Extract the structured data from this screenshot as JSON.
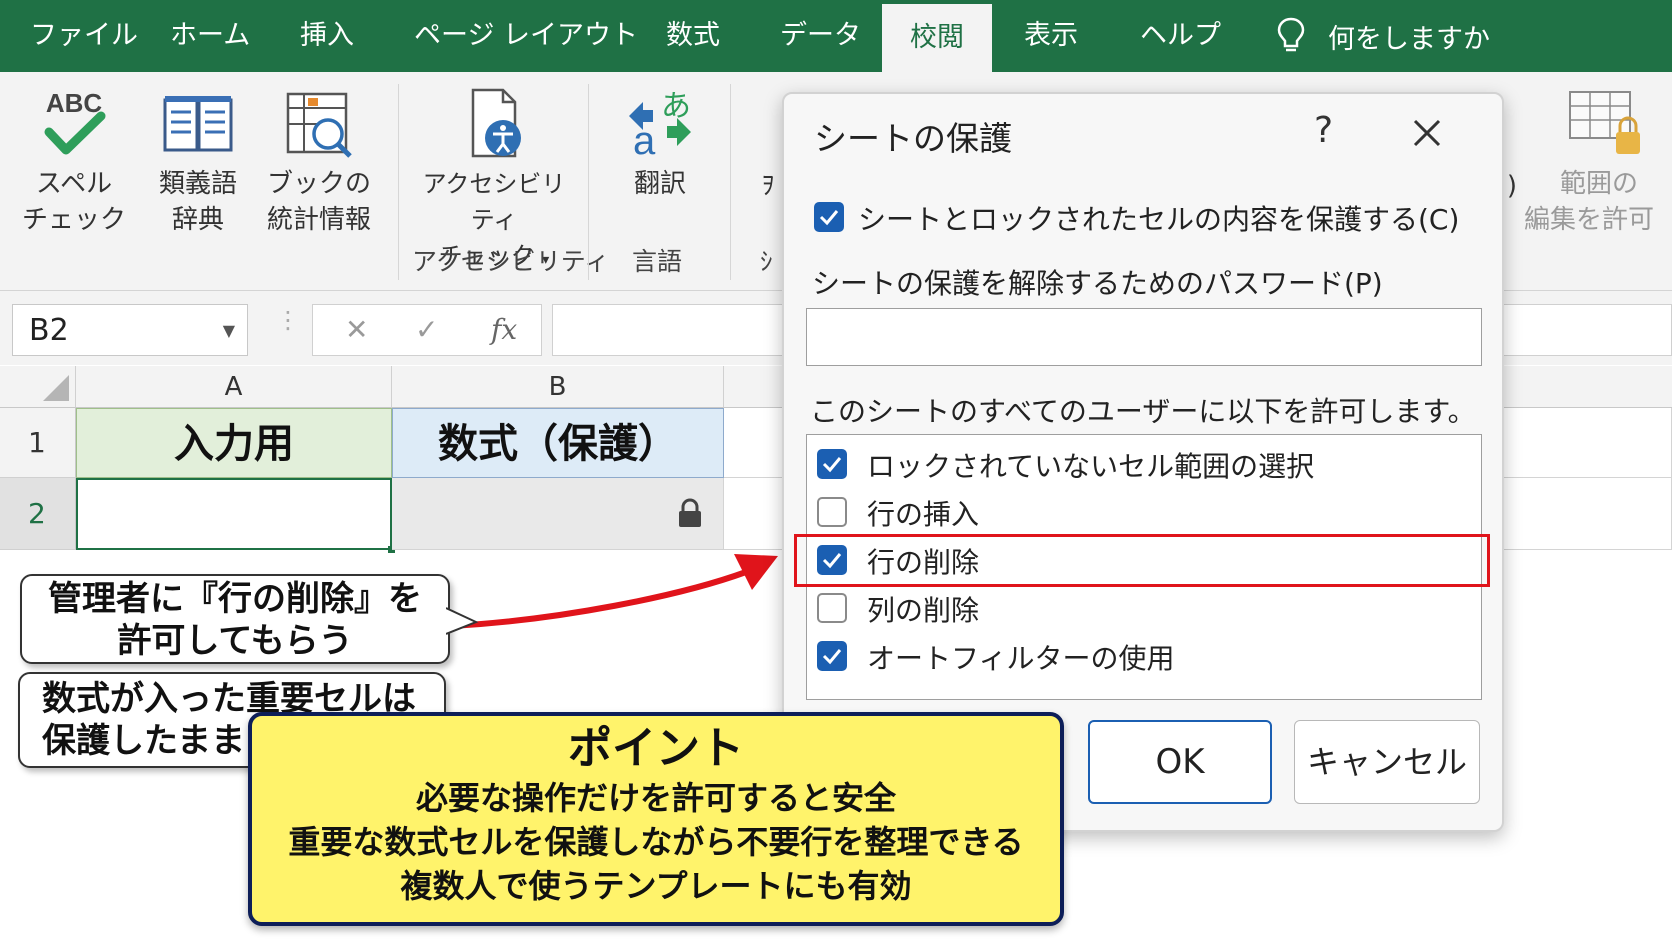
{
  "tabs": [
    {
      "label": "ファイル"
    },
    {
      "label": "ホーム"
    },
    {
      "label": "挿入"
    },
    {
      "label": "ページ レイアウト"
    },
    {
      "label": "数式"
    },
    {
      "label": "データ"
    },
    {
      "label": "校閲",
      "active": true
    },
    {
      "label": "表示"
    },
    {
      "label": "ヘルプ"
    }
  ],
  "tell_me": "何をしますか",
  "ribbon": {
    "spell_line1": "スペル",
    "spell_line2": "チェック",
    "spell_icon_text": "ABC",
    "thesaurus_line1": "類義語",
    "thesaurus_line2": "辞典",
    "stats_line1": "ブックの",
    "stats_line2": "統計情報",
    "access_line1": "アクセシビリティ",
    "access_line2": "チェック",
    "access_group": "アクセシビリティ",
    "translate_label": "翻訳",
    "translate_icon_text": "あ",
    "lang_group": "言語",
    "cut_off_1": "ｦ",
    "cut_off_2": "ｼ",
    "cut_off_3": ")",
    "allow_range_line1": "範囲の",
    "allow_range_line2": "編集を許可"
  },
  "formula_bar": {
    "name_box": "B2",
    "cancel_glyph": "✕",
    "enter_glyph": "✓",
    "fx_glyph": "fx"
  },
  "grid": {
    "col_a": "A",
    "col_b": "B",
    "row_1": "1",
    "row_2": "2",
    "a1": "入力用",
    "b1": "数式（保護）"
  },
  "dialog": {
    "title": "シートの保護",
    "help": "?",
    "protect_label": "シートとロックされたセルの内容を保護する(C)",
    "password_label": "シートの保護を解除するためのパスワード(P)",
    "allow_label": "このシートのすべてのユーザーに以下を許可します。",
    "options": [
      {
        "label": "ロックされていないセル範囲の選択",
        "checked": true
      },
      {
        "label": "行の挿入",
        "checked": false
      },
      {
        "label": "行の削除",
        "checked": true
      },
      {
        "label": "列の削除",
        "checked": false
      },
      {
        "label": "オートフィルターの使用",
        "checked": true
      }
    ],
    "ok": "OK",
    "cancel": "キャンセル"
  },
  "callouts": {
    "c1_line1": "管理者に『行の削除』を",
    "c1_line2": "許可してもらう",
    "c2_line1": "数式が入った重要セルは",
    "c2_line2": "保護したまま"
  },
  "point": {
    "title": "ポイント",
    "lines": [
      "必要な操作だけを許可すると安全",
      "重要な数式セルを保護しながら不要行を整理できる",
      "複数人で使うテンプレートにも有効"
    ]
  },
  "colors": {
    "excel_green": "#1f7145",
    "check_blue": "#1b5fb2",
    "highlight_red": "#e0141b",
    "input_cell_fill": "#e2efda",
    "formula_cell_fill": "#ddebf7",
    "point_fill": "#fff36b",
    "point_border": "#0d1e58"
  }
}
